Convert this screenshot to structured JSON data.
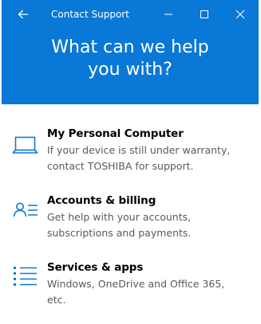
{
  "window": {
    "title": "Contact Support",
    "accent_color": "#0a78d7"
  },
  "titlebar_icons": {
    "back": "arrow-left-icon",
    "minimize": "minimize-icon",
    "maximize": "maximize-icon",
    "close": "close-icon"
  },
  "hero": {
    "line1": "What can we help",
    "line2": "you with?"
  },
  "options": [
    {
      "icon": "laptop-icon",
      "title": "My Personal Computer",
      "desc_line1": "If your device is still under warranty,",
      "desc_line2": "contact TOSHIBA for support."
    },
    {
      "icon": "account-list-icon",
      "title": "Accounts & billing",
      "desc_line1": "Get help with your accounts,",
      "desc_line2": "subscriptions and payments."
    },
    {
      "icon": "bulleted-list-icon",
      "title": "Services & apps",
      "desc_line1": "Windows, OneDrive and Office 365,",
      "desc_line2": "etc."
    }
  ]
}
